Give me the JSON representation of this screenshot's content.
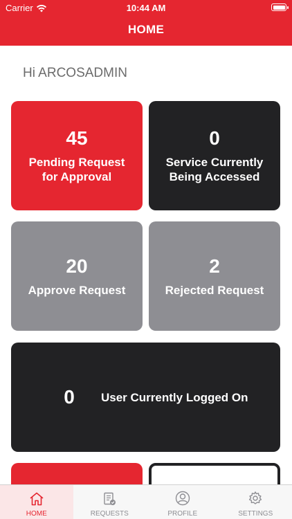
{
  "status": {
    "carrier": "Carrier",
    "time": "10:44 AM"
  },
  "header": {
    "title": "HOME"
  },
  "greeting": "Hi ARCOSADMIN",
  "cards": {
    "pending": {
      "count": "45",
      "label": "Pending Request for Approval"
    },
    "service": {
      "count": "0",
      "label": "Service Currently Being Accessed"
    },
    "approve": {
      "count": "20",
      "label": "Approve Request"
    },
    "rejected": {
      "count": "2",
      "label": "Rejected Request"
    },
    "logged": {
      "count": "0",
      "label": "User Currently Logged On"
    }
  },
  "tabs": [
    {
      "label": "HOME",
      "icon": "home-icon"
    },
    {
      "label": "REQUESTS",
      "icon": "requests-icon"
    },
    {
      "label": "PROFILE",
      "icon": "profile-icon"
    },
    {
      "label": "SETTINGS",
      "icon": "gear-icon"
    }
  ],
  "colors": {
    "brand": "#e52630",
    "dark": "#222224",
    "grey": "#8e8e93"
  }
}
